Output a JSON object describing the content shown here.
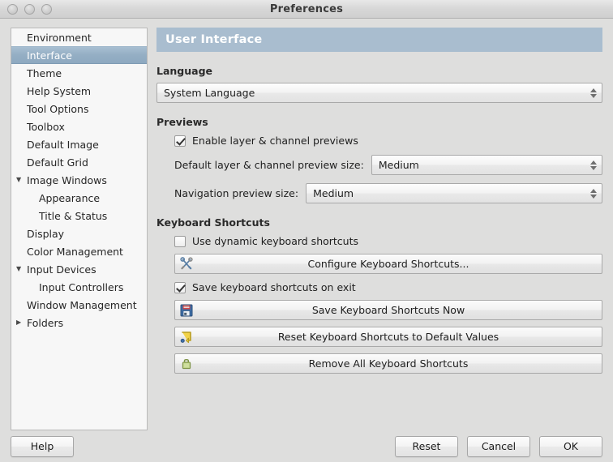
{
  "window": {
    "title": "Preferences",
    "controls": [
      "close-button",
      "minimize-button",
      "zoom-button"
    ]
  },
  "sidebar": {
    "items": [
      {
        "label": "Environment",
        "expander": "",
        "indent": false,
        "selected": false
      },
      {
        "label": "Interface",
        "expander": "",
        "indent": false,
        "selected": true
      },
      {
        "label": "Theme",
        "expander": "",
        "indent": false,
        "selected": false
      },
      {
        "label": "Help System",
        "expander": "",
        "indent": false,
        "selected": false
      },
      {
        "label": "Tool Options",
        "expander": "",
        "indent": false,
        "selected": false
      },
      {
        "label": "Toolbox",
        "expander": "",
        "indent": false,
        "selected": false
      },
      {
        "label": "Default Image",
        "expander": "",
        "indent": false,
        "selected": false
      },
      {
        "label": "Default Grid",
        "expander": "",
        "indent": false,
        "selected": false
      },
      {
        "label": "Image Windows",
        "expander": "▼",
        "indent": false,
        "selected": false
      },
      {
        "label": "Appearance",
        "expander": "",
        "indent": true,
        "selected": false
      },
      {
        "label": "Title & Status",
        "expander": "",
        "indent": true,
        "selected": false
      },
      {
        "label": "Display",
        "expander": "",
        "indent": false,
        "selected": false
      },
      {
        "label": "Color Management",
        "expander": "",
        "indent": false,
        "selected": false
      },
      {
        "label": "Input Devices",
        "expander": "▼",
        "indent": false,
        "selected": false
      },
      {
        "label": "Input Controllers",
        "expander": "",
        "indent": true,
        "selected": false
      },
      {
        "label": "Window Management",
        "expander": "",
        "indent": false,
        "selected": false
      },
      {
        "label": "Folders",
        "expander": "▶",
        "indent": false,
        "selected": false
      }
    ]
  },
  "main": {
    "header": "User Interface",
    "language": {
      "section_title": "Language",
      "value": "System Language"
    },
    "previews": {
      "section_title": "Previews",
      "enable_checkbox": {
        "label": "Enable layer & channel previews",
        "checked": true
      },
      "default_size": {
        "label": "Default layer & channel preview size:",
        "value": "Medium"
      },
      "navigation_size": {
        "label": "Navigation preview size:",
        "value": "Medium"
      }
    },
    "keyboard_shortcuts": {
      "section_title": "Keyboard Shortcuts",
      "dynamic_checkbox": {
        "label": "Use dynamic keyboard shortcuts",
        "checked": false
      },
      "configure_button": {
        "label": "Configure Keyboard Shortcuts...",
        "icon": "wrench-screwdriver-icon"
      },
      "save_on_exit_checkbox": {
        "label": "Save keyboard shortcuts on exit",
        "checked": true
      },
      "save_now_button": {
        "label": "Save Keyboard Shortcuts Now",
        "icon": "floppy-disk-icon"
      },
      "reset_button": {
        "label": "Reset Keyboard Shortcuts to Default Values",
        "icon": "reset-arrow-icon"
      },
      "remove_button": {
        "label": "Remove All Keyboard Shortcuts",
        "icon": "eraser-icon"
      }
    }
  },
  "footer": {
    "help": "Help",
    "reset": "Reset",
    "cancel": "Cancel",
    "ok": "OK"
  },
  "colors": {
    "panel_header_bg": "#a9bdcf",
    "selected_item_bg": "#94aec4",
    "window_bg": "#dededd",
    "list_bg": "#f7f7f7"
  }
}
